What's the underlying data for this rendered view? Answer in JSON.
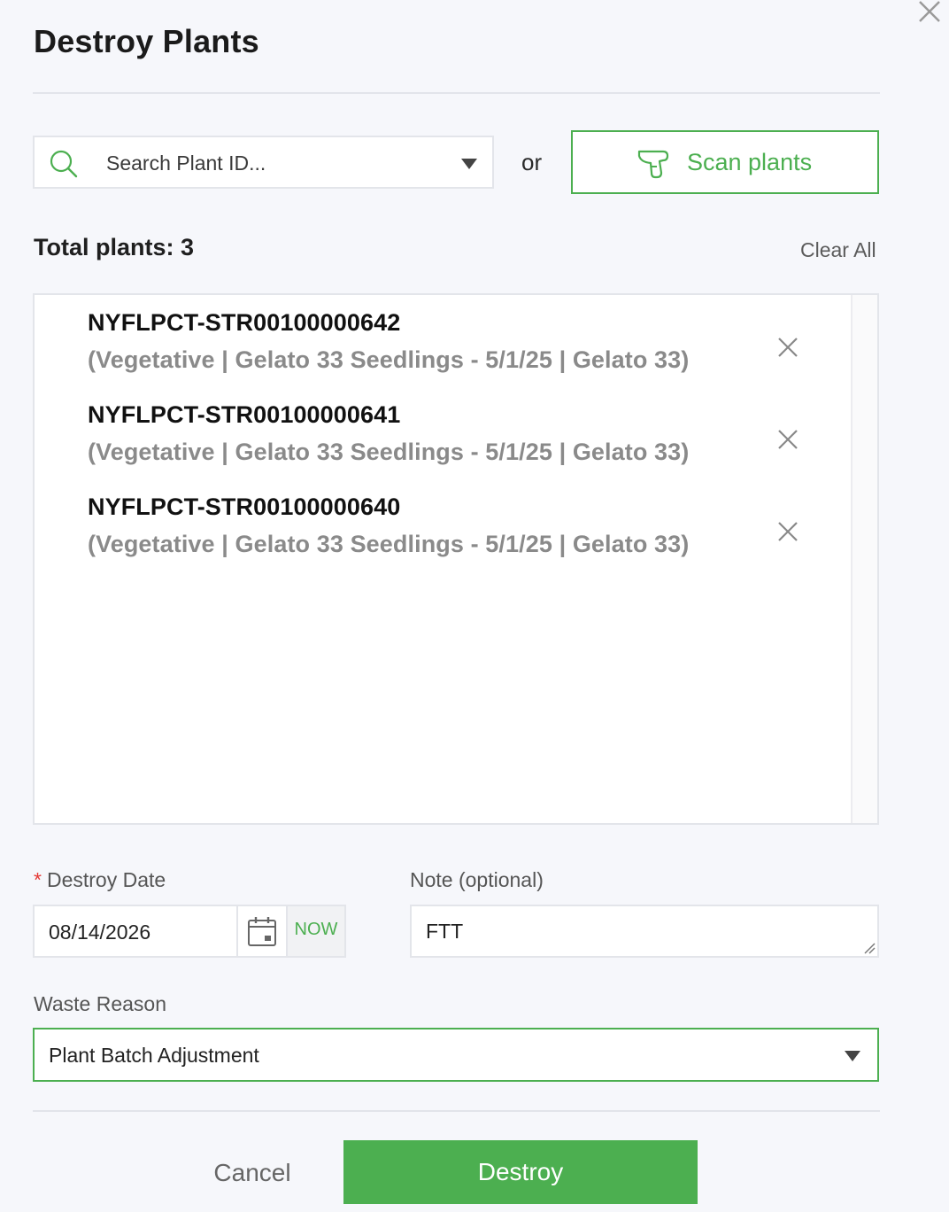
{
  "modal": {
    "title": "Destroy Plants",
    "close_icon": "close-icon"
  },
  "search": {
    "placeholder": "Search Plant ID...",
    "icon": "search-icon"
  },
  "or_text": "or",
  "scan": {
    "label": "Scan plants",
    "icon": "barcode-scanner-icon"
  },
  "summary": {
    "total_label": "Total plants: 3",
    "clear_all": "Clear All"
  },
  "plants": [
    {
      "id": "NYFLPCT-STR00100000642",
      "desc": "(Vegetative | Gelato 33 Seedlings - 5/1/25 | Gelato 33)"
    },
    {
      "id": "NYFLPCT-STR00100000641",
      "desc": "(Vegetative | Gelato 33 Seedlings - 5/1/25 | Gelato 33)"
    },
    {
      "id": "NYFLPCT-STR00100000640",
      "desc": "(Vegetative | Gelato 33 Seedlings - 5/1/25 | Gelato 33)"
    }
  ],
  "destroy_date": {
    "required_mark": "*",
    "label": "Destroy Date",
    "value": "08/14/2026",
    "now_label": "NOW",
    "icon": "calendar-icon"
  },
  "note": {
    "label": "Note (optional)",
    "value": "FTT"
  },
  "waste_reason": {
    "label": "Waste Reason",
    "value": "Plant Batch Adjustment"
  },
  "actions": {
    "cancel": "Cancel",
    "destroy": "Destroy"
  },
  "colors": {
    "accent": "#4caf50",
    "required": "#e53935",
    "muted_text": "#8a8a8a",
    "background": "#f6f7fb"
  }
}
